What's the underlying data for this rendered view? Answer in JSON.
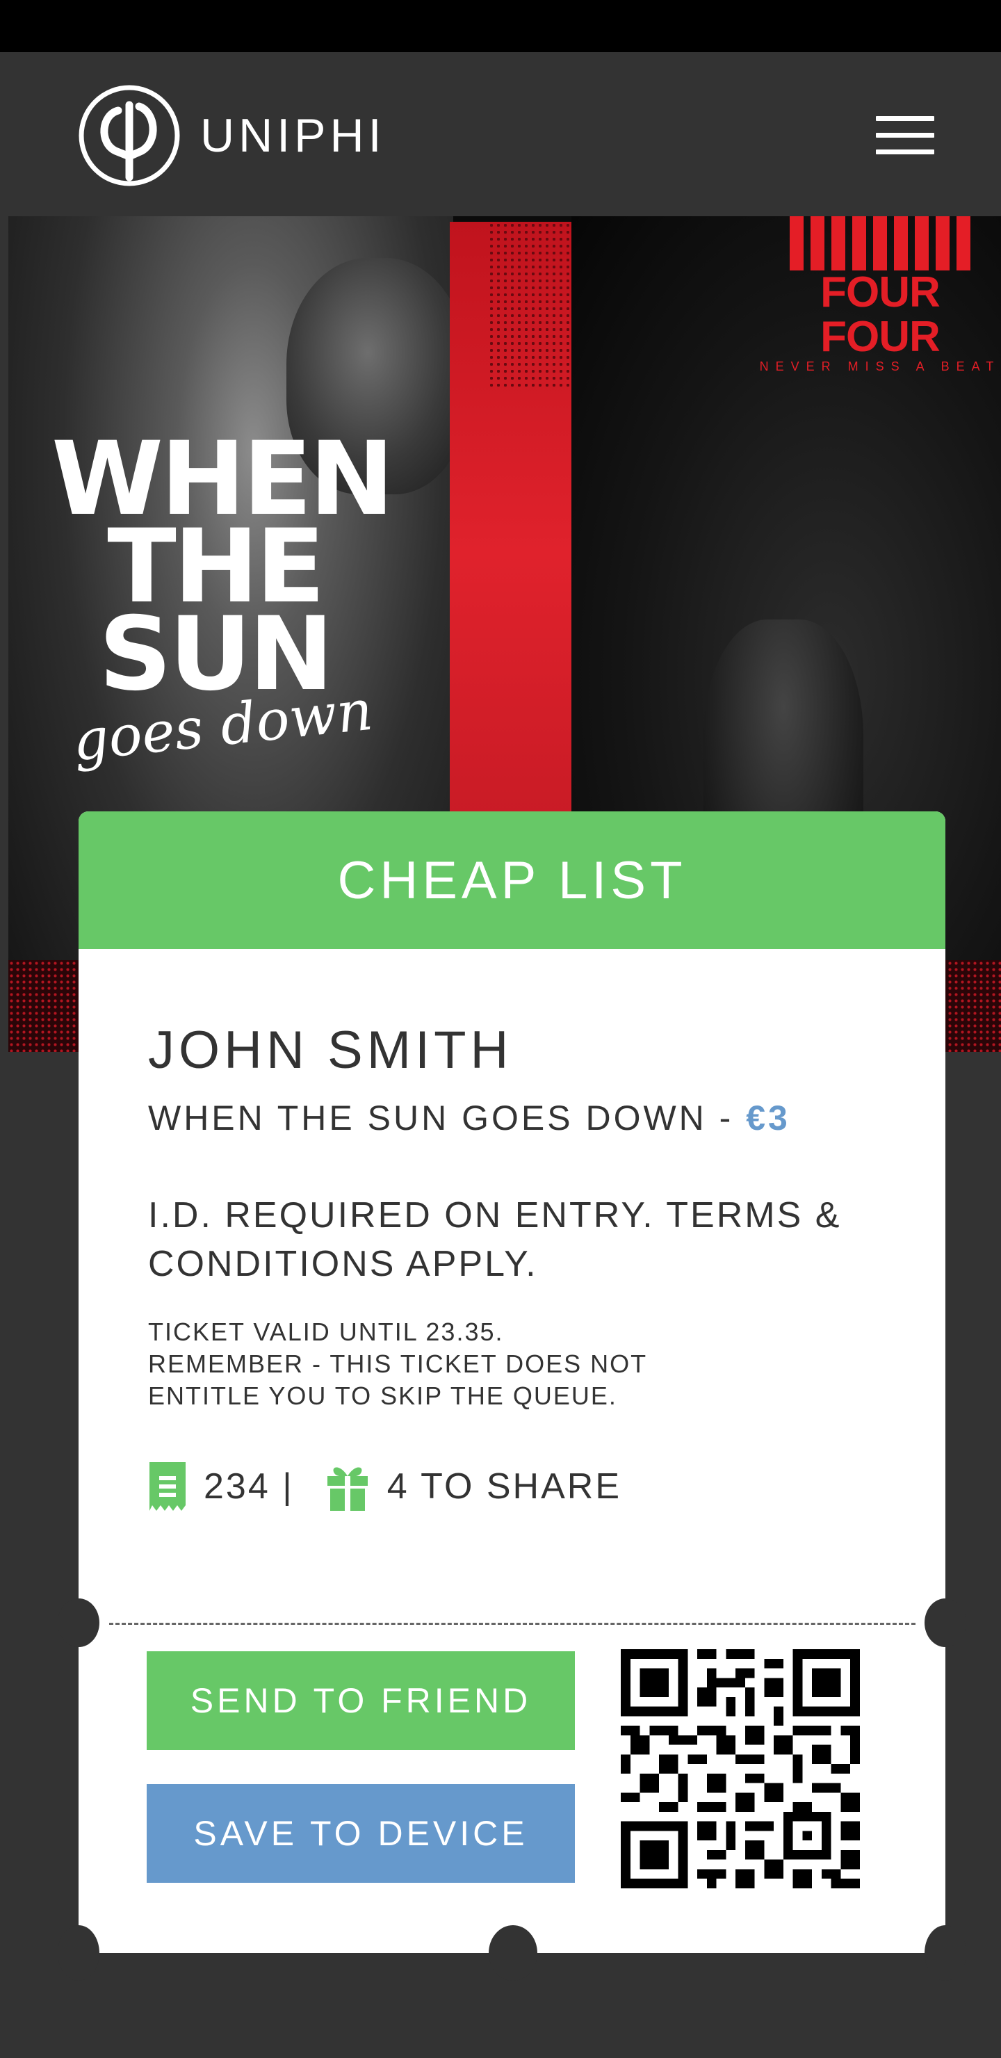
{
  "header": {
    "brand_name": "UNIPHI",
    "logo_icon": "uniphi-logo-icon",
    "menu_icon": "hamburger-menu-icon"
  },
  "hero": {
    "title_lines": [
      "WHEN",
      "THE",
      "SUN"
    ],
    "script": "goes down",
    "promoter_name": "FOUR FOUR",
    "promoter_tagline": "NEVER MISS A BEAT"
  },
  "ticket": {
    "list_name": "CHEAP LIST",
    "holder_name": "JOHN SMITH",
    "event_name": "WHEN THE SUN GOES DOWN - ",
    "price": "€3",
    "terms": "I.D. REQUIRED ON ENTRY. TERMS & CONDITIONS APPLY.",
    "validity_lines": [
      "TICKET VALID UNTIL 23.35.",
      "REMEMBER - THIS TICKET DOES NOT",
      "ENTITLE YOU TO SKIP THE QUEUE."
    ],
    "ticket_number": "234 |",
    "share_count": "4 TO SHARE",
    "send_label": "SEND TO FRIEND",
    "save_label": "SAVE TO DEVICE"
  },
  "colors": {
    "background": "#333333",
    "accent_green": "#67c867",
    "accent_blue": "#6699cc",
    "promoter_red": "#e41e26"
  }
}
